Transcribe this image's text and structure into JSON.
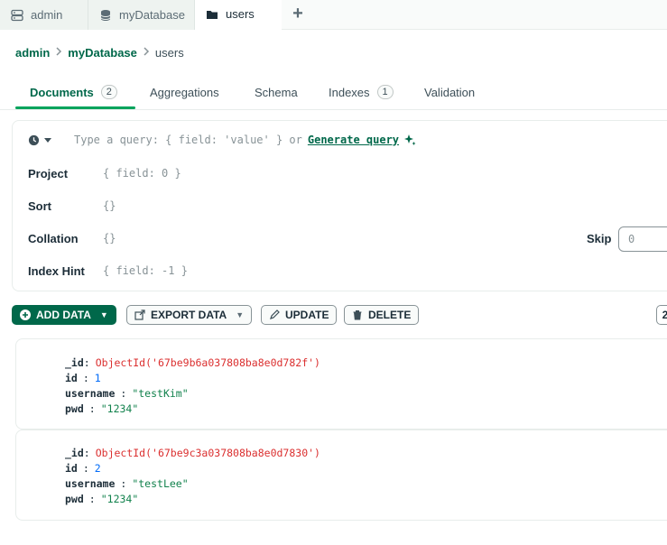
{
  "tabs": [
    {
      "label": "admin",
      "icon": "server-icon"
    },
    {
      "label": "myDatabase",
      "icon": "database-icon"
    },
    {
      "label": "users",
      "icon": "folder-icon"
    }
  ],
  "breadcrumb": {
    "part1": "admin",
    "part2": "myDatabase",
    "part3": "users"
  },
  "subtabs": {
    "documents": {
      "label": "Documents",
      "count": "2"
    },
    "aggregations": {
      "label": "Aggregations"
    },
    "schema": {
      "label": "Schema"
    },
    "indexes": {
      "label": "Indexes",
      "count": "1"
    },
    "validation": {
      "label": "Validation"
    }
  },
  "query": {
    "placeholder": "Type a query: { field: 'value' } or",
    "generate": "Generate query",
    "project_label": "Project",
    "project_placeholder": "{ field: 0 }",
    "sort_label": "Sort",
    "sort_placeholder": "{}",
    "collation_label": "Collation",
    "collation_placeholder": "{}",
    "hint_label": "Index Hint",
    "hint_placeholder": "{ field: -1 }",
    "skip_label": "Skip",
    "skip_placeholder": "0"
  },
  "toolbar": {
    "add_data": "ADD DATA",
    "export_data": "EXPORT DATA",
    "update": "UPDATE",
    "delete": "DELETE",
    "page": "2"
  },
  "documents": [
    {
      "id_key": "_id",
      "oid": "ObjectId('67be9b6a037808ba8e0d782f')",
      "id_label": "id",
      "id": "1",
      "username_label": "username",
      "username": "\"testKim\"",
      "pwd_label": "pwd",
      "pwd": "\"1234\""
    },
    {
      "id_key": "_id",
      "oid": "ObjectId('67be9c3a037808ba8e0d7830')",
      "id_label": "id",
      "id": "2",
      "username_label": "username",
      "username": "\"testLee\"",
      "pwd_label": "pwd",
      "pwd": "\"1234\""
    }
  ],
  "colors": {
    "accent": "#00684a",
    "tab_underline": "#00a35c",
    "objectid": "#db3030",
    "number": "#016bf8",
    "string": "#12824d"
  }
}
